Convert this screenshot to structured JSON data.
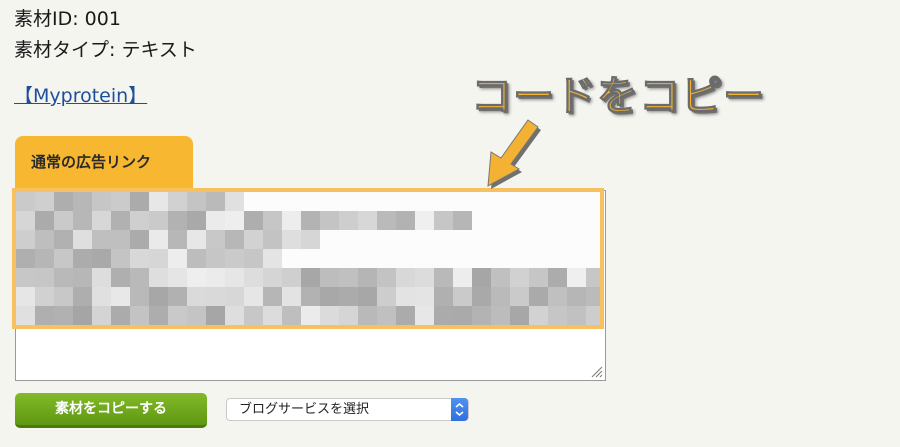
{
  "material": {
    "id_line": "素材ID: 001",
    "type_line": "素材タイプ: テキスト"
  },
  "link": {
    "label": "【Myprotein】"
  },
  "tab": {
    "label": "通常の広告リンク"
  },
  "annotation": {
    "text": "コードをコピー"
  },
  "actions": {
    "copy_label": "素材をコピーする",
    "blog_select": {
      "selected": "ブログサービスを選択"
    }
  },
  "colors": {
    "accent_orange": "#f7b730",
    "highlight_border": "#f7c060",
    "copy_button": "#6ea71c",
    "link": "#1f4f9b",
    "select_arrow": "#2f6fe0"
  },
  "icons": [
    "down-arrow-icon",
    "resize-grip-icon",
    "select-arrows-icon"
  ]
}
